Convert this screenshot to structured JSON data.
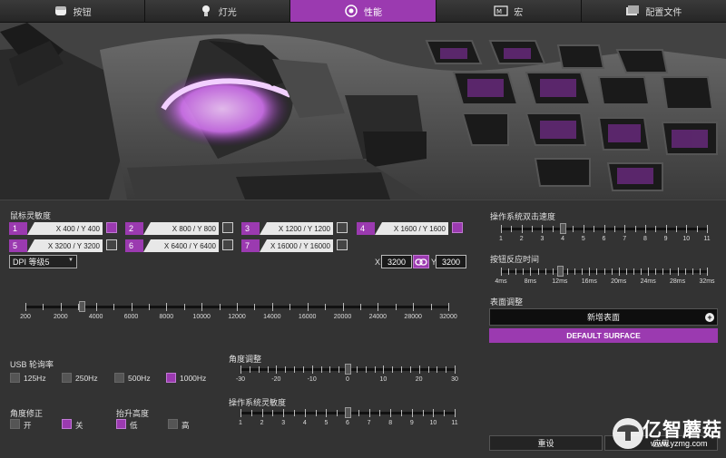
{
  "tabs": [
    {
      "label": "按钮",
      "icon": "mouse-icon"
    },
    {
      "label": "灯光",
      "icon": "bulb-icon"
    },
    {
      "label": "性能",
      "icon": "gauge-icon",
      "active": true
    },
    {
      "label": "宏",
      "icon": "macro-icon"
    },
    {
      "label": "配置文件",
      "icon": "profile-icon"
    }
  ],
  "colors": {
    "accent": "#9b3ab0",
    "panel": "#333333",
    "glow": "#d98bf0"
  },
  "sensitivity": {
    "title": "鼠标灵敏度",
    "presets": [
      {
        "num": "1",
        "value": "X 400 / Y 400",
        "enabled": true
      },
      {
        "num": "2",
        "value": "X 800 / Y 800",
        "enabled": false
      },
      {
        "num": "3",
        "value": "X 1200 / Y 1200",
        "enabled": false
      },
      {
        "num": "4",
        "value": "X 1600 / Y 1600",
        "enabled": true
      },
      {
        "num": "5",
        "value": "X 3200 / Y 3200",
        "enabled": false
      },
      {
        "num": "6",
        "value": "X 6400 / Y 6400",
        "enabled": false
      },
      {
        "num": "7",
        "value": "X 16000 / Y 16000",
        "enabled": false
      }
    ],
    "level_select": "DPI 等级5",
    "x_label": "X",
    "x_value": "3200",
    "y_label": "Y",
    "y_value": "3200",
    "dpi_slider": {
      "ticks": [
        "200",
        "2000",
        "4000",
        "6000",
        "8000",
        "10000",
        "12000",
        "14000",
        "16000",
        "20000",
        "24000",
        "28000",
        "32000"
      ],
      "value": 3200
    }
  },
  "usb": {
    "title": "USB 轮询率",
    "options": [
      {
        "label": "125Hz",
        "checked": false
      },
      {
        "label": "250Hz",
        "checked": false
      },
      {
        "label": "500Hz",
        "checked": false
      },
      {
        "label": "1000Hz",
        "checked": true
      }
    ]
  },
  "angle_snap": {
    "title": "角度修正",
    "options": [
      {
        "label": "开",
        "checked": false
      },
      {
        "label": "关",
        "checked": true
      }
    ]
  },
  "lift_off": {
    "title": "抬升高度",
    "options": [
      {
        "label": "低",
        "checked": true
      },
      {
        "label": "高",
        "checked": false
      }
    ]
  },
  "angle_tuning": {
    "title": "角度调整",
    "ticks": [
      "-30",
      "-20",
      "-10",
      "0",
      "10",
      "20",
      "30"
    ],
    "value": 0
  },
  "os_sensitivity": {
    "title": "操作系统灵敏度",
    "ticks": [
      "1",
      "2",
      "3",
      "4",
      "5",
      "6",
      "7",
      "8",
      "9",
      "10",
      "11"
    ],
    "value": 6
  },
  "double_click": {
    "title": "操作系统双击速度",
    "ticks": [
      "1",
      "2",
      "3",
      "4",
      "5",
      "6",
      "7",
      "8",
      "9",
      "10",
      "11"
    ],
    "value": 4
  },
  "button_response": {
    "title": "按钮反应时间",
    "ticks": [
      "4ms",
      "8ms",
      "12ms",
      "16ms",
      "20ms",
      "24ms",
      "28ms",
      "32ms"
    ],
    "value": "12ms"
  },
  "surface": {
    "title": "表面调整",
    "new_surface": "新增表面",
    "default_surface": "DEFAULT SURFACE"
  },
  "buttons": {
    "reset": "重设",
    "apply": "应用"
  },
  "watermark": {
    "brand": "亿智蘑菇",
    "url": "www.yzmg.com"
  }
}
